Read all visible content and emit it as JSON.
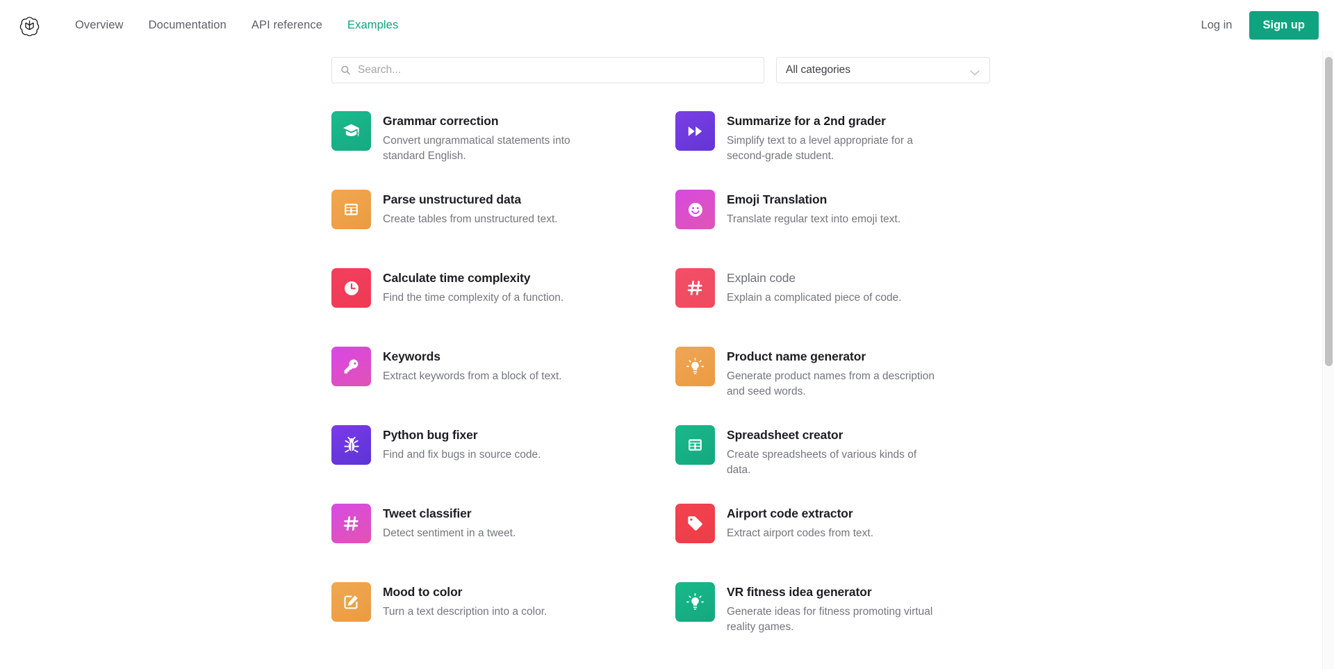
{
  "header": {
    "logo_icon": "openai-logo-icon",
    "nav": [
      {
        "label": "Overview",
        "active": false
      },
      {
        "label": "Documentation",
        "active": false
      },
      {
        "label": "API reference",
        "active": false
      },
      {
        "label": "Examples",
        "active": true
      }
    ],
    "login_label": "Log in",
    "signup_label": "Sign up",
    "accent_color": "#10a37f"
  },
  "search": {
    "value": "",
    "placeholder": "Search...",
    "icon": "search-icon"
  },
  "category_filter": {
    "selected": "All categories",
    "icon": "chevron-down-icon"
  },
  "examples": [
    {
      "title": "Grammar correction",
      "description": "Convert ungrammatical statements into standard English.",
      "icon": "graduation-cap-icon",
      "color_from": "#1abb8d",
      "color_to": "#17a982",
      "muted": false
    },
    {
      "title": "Summarize for a 2nd grader",
      "description": "Simplify text to a level appropriate for a second-grade student.",
      "icon": "fast-forward-icon",
      "color_from": "#7b3fe4",
      "color_to": "#6334d6",
      "muted": false
    },
    {
      "title": "Parse unstructured data",
      "description": "Create tables from unstructured text.",
      "icon": "table-icon",
      "color_from": "#f0a850",
      "color_to": "#eb9b41",
      "muted": false
    },
    {
      "title": "Emoji Translation",
      "description": "Translate regular text into emoji text.",
      "icon": "smiley-face-icon",
      "color_from": "#d64ae0",
      "color_to": "#e055b4",
      "muted": false
    },
    {
      "title": "Calculate time complexity",
      "description": "Find the time complexity of a function.",
      "icon": "clock-icon",
      "color_from": "#f23f5d",
      "color_to": "#ee3a53",
      "muted": false
    },
    {
      "title": "Explain code",
      "description": "Explain a complicated piece of code.",
      "icon": "hash-icon",
      "color_from": "#f25068",
      "color_to": "#ef4a5e",
      "muted": true
    },
    {
      "title": "Keywords",
      "description": "Extract keywords from a block of text.",
      "icon": "key-icon",
      "color_from": "#d946e8",
      "color_to": "#e052b2",
      "muted": false
    },
    {
      "title": "Product name generator",
      "description": "Generate product names from a description and seed words.",
      "icon": "lightbulb-icon",
      "color_from": "#efa655",
      "color_to": "#eb9b41",
      "muted": false
    },
    {
      "title": "Python bug fixer",
      "description": "Find and fix bugs in source code.",
      "icon": "bug-icon",
      "color_from": "#7c3ae8",
      "color_to": "#5b34d6",
      "muted": false
    },
    {
      "title": "Spreadsheet creator",
      "description": "Create spreadsheets of various kinds of data.",
      "icon": "spreadsheet-icon",
      "color_from": "#18b98a",
      "color_to": "#14a87e",
      "muted": false
    },
    {
      "title": "Tweet classifier",
      "description": "Detect sentiment in a tweet.",
      "icon": "hash-icon",
      "color_from": "#d84ae5",
      "color_to": "#e054b0",
      "muted": false
    },
    {
      "title": "Airport code extractor",
      "description": "Extract airport codes from text.",
      "icon": "tag-icon",
      "color_from": "#f2434f",
      "color_to": "#ed3c47",
      "muted": false
    },
    {
      "title": "Mood to color",
      "description": "Turn a text description into a color.",
      "icon": "pencil-square-icon",
      "color_from": "#f0a850",
      "color_to": "#eb9b41",
      "muted": false
    },
    {
      "title": "VR fitness idea generator",
      "description": "Generate ideas for fitness promoting virtual reality games.",
      "icon": "lightbulb-icon",
      "color_from": "#18b98a",
      "color_to": "#14a87e",
      "muted": false
    }
  ],
  "scrollbar": {
    "thumb_top_pct": 1,
    "thumb_height_pct": 50
  }
}
